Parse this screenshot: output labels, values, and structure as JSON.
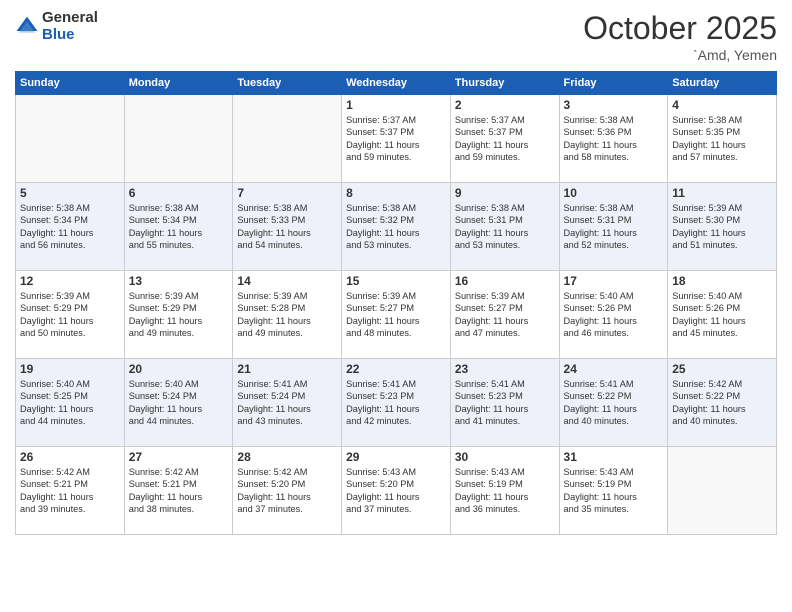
{
  "header": {
    "logo_general": "General",
    "logo_blue": "Blue",
    "month_title": "October 2025",
    "location": "`Amd, Yemen"
  },
  "weekdays": [
    "Sunday",
    "Monday",
    "Tuesday",
    "Wednesday",
    "Thursday",
    "Friday",
    "Saturday"
  ],
  "weeks": [
    [
      {
        "day": "",
        "info": ""
      },
      {
        "day": "",
        "info": ""
      },
      {
        "day": "",
        "info": ""
      },
      {
        "day": "1",
        "info": "Sunrise: 5:37 AM\nSunset: 5:37 PM\nDaylight: 11 hours\nand 59 minutes."
      },
      {
        "day": "2",
        "info": "Sunrise: 5:37 AM\nSunset: 5:37 PM\nDaylight: 11 hours\nand 59 minutes."
      },
      {
        "day": "3",
        "info": "Sunrise: 5:38 AM\nSunset: 5:36 PM\nDaylight: 11 hours\nand 58 minutes."
      },
      {
        "day": "4",
        "info": "Sunrise: 5:38 AM\nSunset: 5:35 PM\nDaylight: 11 hours\nand 57 minutes."
      }
    ],
    [
      {
        "day": "5",
        "info": "Sunrise: 5:38 AM\nSunset: 5:34 PM\nDaylight: 11 hours\nand 56 minutes."
      },
      {
        "day": "6",
        "info": "Sunrise: 5:38 AM\nSunset: 5:34 PM\nDaylight: 11 hours\nand 55 minutes."
      },
      {
        "day": "7",
        "info": "Sunrise: 5:38 AM\nSunset: 5:33 PM\nDaylight: 11 hours\nand 54 minutes."
      },
      {
        "day": "8",
        "info": "Sunrise: 5:38 AM\nSunset: 5:32 PM\nDaylight: 11 hours\nand 53 minutes."
      },
      {
        "day": "9",
        "info": "Sunrise: 5:38 AM\nSunset: 5:31 PM\nDaylight: 11 hours\nand 53 minutes."
      },
      {
        "day": "10",
        "info": "Sunrise: 5:38 AM\nSunset: 5:31 PM\nDaylight: 11 hours\nand 52 minutes."
      },
      {
        "day": "11",
        "info": "Sunrise: 5:39 AM\nSunset: 5:30 PM\nDaylight: 11 hours\nand 51 minutes."
      }
    ],
    [
      {
        "day": "12",
        "info": "Sunrise: 5:39 AM\nSunset: 5:29 PM\nDaylight: 11 hours\nand 50 minutes."
      },
      {
        "day": "13",
        "info": "Sunrise: 5:39 AM\nSunset: 5:29 PM\nDaylight: 11 hours\nand 49 minutes."
      },
      {
        "day": "14",
        "info": "Sunrise: 5:39 AM\nSunset: 5:28 PM\nDaylight: 11 hours\nand 49 minutes."
      },
      {
        "day": "15",
        "info": "Sunrise: 5:39 AM\nSunset: 5:27 PM\nDaylight: 11 hours\nand 48 minutes."
      },
      {
        "day": "16",
        "info": "Sunrise: 5:39 AM\nSunset: 5:27 PM\nDaylight: 11 hours\nand 47 minutes."
      },
      {
        "day": "17",
        "info": "Sunrise: 5:40 AM\nSunset: 5:26 PM\nDaylight: 11 hours\nand 46 minutes."
      },
      {
        "day": "18",
        "info": "Sunrise: 5:40 AM\nSunset: 5:26 PM\nDaylight: 11 hours\nand 45 minutes."
      }
    ],
    [
      {
        "day": "19",
        "info": "Sunrise: 5:40 AM\nSunset: 5:25 PM\nDaylight: 11 hours\nand 44 minutes."
      },
      {
        "day": "20",
        "info": "Sunrise: 5:40 AM\nSunset: 5:24 PM\nDaylight: 11 hours\nand 44 minutes."
      },
      {
        "day": "21",
        "info": "Sunrise: 5:41 AM\nSunset: 5:24 PM\nDaylight: 11 hours\nand 43 minutes."
      },
      {
        "day": "22",
        "info": "Sunrise: 5:41 AM\nSunset: 5:23 PM\nDaylight: 11 hours\nand 42 minutes."
      },
      {
        "day": "23",
        "info": "Sunrise: 5:41 AM\nSunset: 5:23 PM\nDaylight: 11 hours\nand 41 minutes."
      },
      {
        "day": "24",
        "info": "Sunrise: 5:41 AM\nSunset: 5:22 PM\nDaylight: 11 hours\nand 40 minutes."
      },
      {
        "day": "25",
        "info": "Sunrise: 5:42 AM\nSunset: 5:22 PM\nDaylight: 11 hours\nand 40 minutes."
      }
    ],
    [
      {
        "day": "26",
        "info": "Sunrise: 5:42 AM\nSunset: 5:21 PM\nDaylight: 11 hours\nand 39 minutes."
      },
      {
        "day": "27",
        "info": "Sunrise: 5:42 AM\nSunset: 5:21 PM\nDaylight: 11 hours\nand 38 minutes."
      },
      {
        "day": "28",
        "info": "Sunrise: 5:42 AM\nSunset: 5:20 PM\nDaylight: 11 hours\nand 37 minutes."
      },
      {
        "day": "29",
        "info": "Sunrise: 5:43 AM\nSunset: 5:20 PM\nDaylight: 11 hours\nand 37 minutes."
      },
      {
        "day": "30",
        "info": "Sunrise: 5:43 AM\nSunset: 5:19 PM\nDaylight: 11 hours\nand 36 minutes."
      },
      {
        "day": "31",
        "info": "Sunrise: 5:43 AM\nSunset: 5:19 PM\nDaylight: 11 hours\nand 35 minutes."
      },
      {
        "day": "",
        "info": ""
      }
    ]
  ]
}
